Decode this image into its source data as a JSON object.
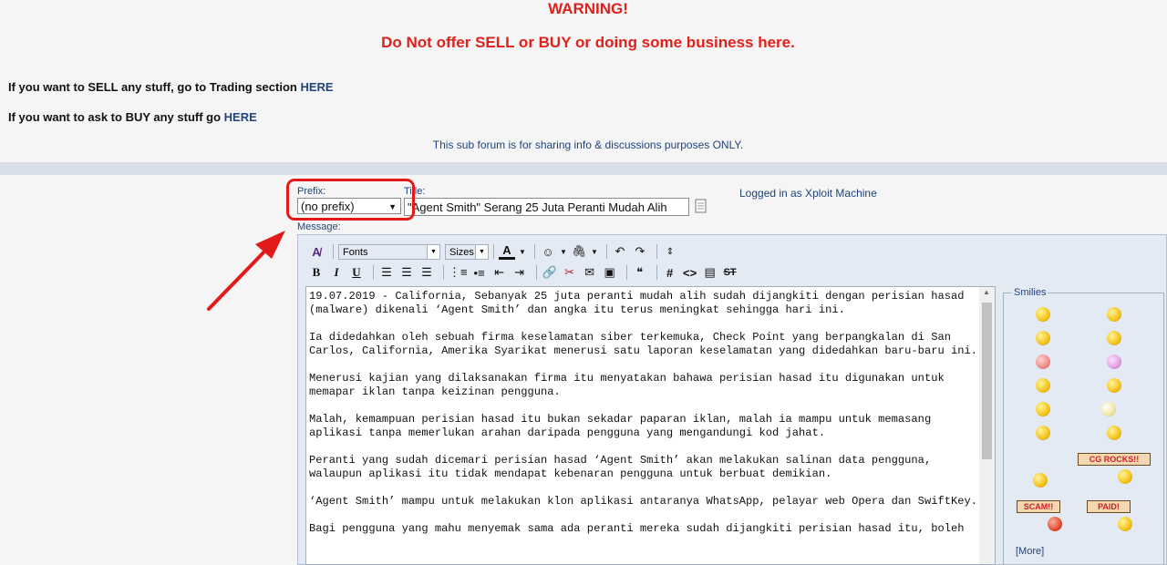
{
  "notice": {
    "warning_title": "WARNING!",
    "warning_subtitle": "Do Not offer SELL or BUY or doing some business here.",
    "sell_text": "If you want to SELL any stuff, go to Trading section ",
    "sell_link": "HERE",
    "buy_text": "If you want to ask to BUY any stuff go ",
    "buy_link": "HERE",
    "subforum_note": "This sub forum is for sharing info & discussions purposes ONLY."
  },
  "form": {
    "prefix_label": "Prefix:",
    "prefix_value": "(no prefix)",
    "title_label": "Title:",
    "title_value": "\"Agent Smith\" Serang 25 Juta Peranti Mudah Alih",
    "logged_in": "Logged in as Xploit Machine",
    "message_label": "Message:"
  },
  "toolbar": {
    "fonts_label": "Fonts",
    "sizes_label": "Sizes"
  },
  "message": {
    "body": "19.07.2019 - California, Sebanyak 25 juta peranti mudah alih sudah dijangkiti dengan perisian hasad (malware) dikenali ‘Agent Smith’ dan angka itu terus meningkat sehingga hari ini.\n\nIa didedahkan oleh sebuah firma keselamatan siber terkemuka, Check Point yang berpangkalan di San Carlos, California, Amerika Syarikat menerusi satu laporan keselamatan yang didedahkan baru-baru ini.\n\nMenerusi kajian yang dilaksanakan firma itu menyatakan bahawa perisian hasad itu digunakan untuk memapar iklan tanpa keizinan pengguna.\n\nMalah, kemampuan perisian hasad itu bukan sekadar paparan iklan, malah ia mampu untuk memasang aplikasi tanpa memerlukan arahan daripada pengguna yang mengandungi kod jahat.\n\nPeranti yang sudah dicemari perisian hasad ‘Agent Smith’ akan melakukan salinan data pengguna, walaupun aplikasi itu tidak mendapat kebenaran pengguna untuk berbuat demikian.\n\n‘Agent Smith’ mampu untuk melakukan klon aplikasi antaranya WhatsApp, pelayar web Opera dan SwiftKey.\n\nBagi pengguna yang mahu menyemak sama ada peranti mereka sudah dijangkiti perisian hasad itu, boleh"
  },
  "smilies": {
    "legend": "Smilies",
    "sign_rocks": "CG ROCKS!!",
    "sign_scam": "SCAM!!",
    "sign_paid": "PAID!",
    "more_link": "[More]"
  },
  "colors": {
    "warning": "#e0201b",
    "link": "#22447a",
    "highlight": "#e21a1a"
  }
}
